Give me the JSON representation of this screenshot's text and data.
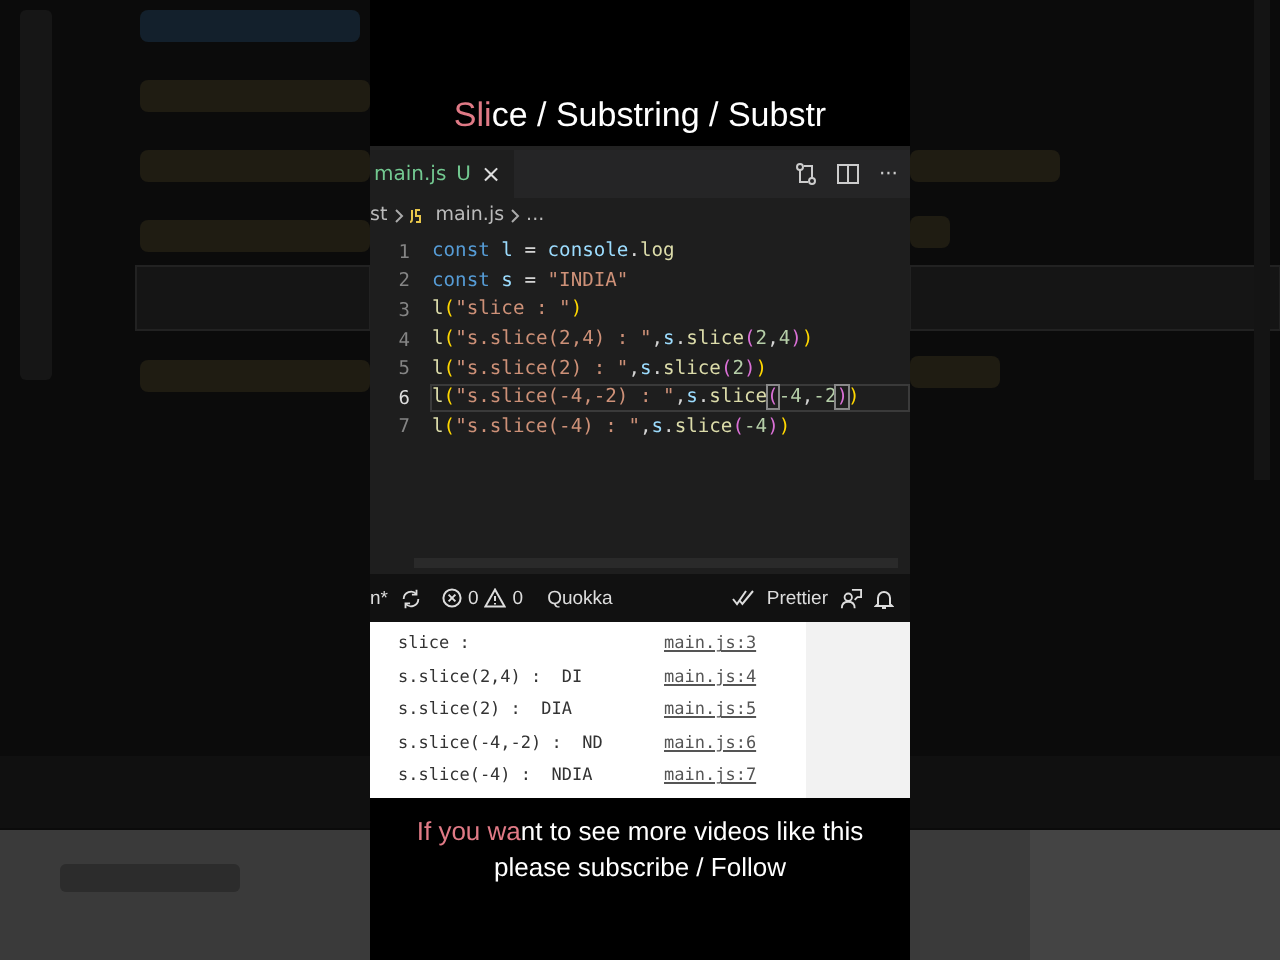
{
  "caption": {
    "highlight": "Sli",
    "rest": "ce / Substring / Substr"
  },
  "editor": {
    "tab": {
      "label": "main.js",
      "status": "U",
      "close": "×",
      "selected": true
    },
    "more": "···",
    "breadcrumb": [
      "st",
      "main.js",
      "..."
    ],
    "lines": [
      {
        "number": "1",
        "current": false,
        "tokens": [
          {
            "text": "const ",
            "kind": "kw"
          },
          {
            "text": "l",
            "kind": "var"
          },
          {
            "text": " = ",
            "kind": "op"
          },
          {
            "text": "console",
            "kind": "var"
          },
          {
            "text": ".",
            "kind": "op"
          },
          {
            "text": "log",
            "kind": "fn"
          }
        ]
      },
      {
        "number": "2",
        "current": false,
        "tokens": [
          {
            "text": "const ",
            "kind": "kw"
          },
          {
            "text": "s",
            "kind": "var"
          },
          {
            "text": " = ",
            "kind": "op"
          },
          {
            "text": "\"INDIA\"",
            "kind": "str"
          }
        ]
      },
      {
        "number": "3",
        "current": false,
        "tokens": [
          {
            "text": "l",
            "kind": "fn"
          },
          {
            "text": "(",
            "kind": "b1"
          },
          {
            "text": "\"slice : \"",
            "kind": "str"
          },
          {
            "text": ")",
            "kind": "b1"
          }
        ]
      },
      {
        "number": "4",
        "current": false,
        "tokens": [
          {
            "text": "l",
            "kind": "fn"
          },
          {
            "text": "(",
            "kind": "b1"
          },
          {
            "text": "\"s.slice(2,4) : \"",
            "kind": "str"
          },
          {
            "text": ",",
            "kind": "op"
          },
          {
            "text": "s",
            "kind": "var"
          },
          {
            "text": ".",
            "kind": "op"
          },
          {
            "text": "slice",
            "kind": "fn"
          },
          {
            "text": "(",
            "kind": "b2"
          },
          {
            "text": "2",
            "kind": "num"
          },
          {
            "text": ",",
            "kind": "op"
          },
          {
            "text": "4",
            "kind": "num"
          },
          {
            "text": ")",
            "kind": "b2"
          },
          {
            "text": ")",
            "kind": "b1"
          }
        ]
      },
      {
        "number": "5",
        "current": false,
        "tokens": [
          {
            "text": "l",
            "kind": "fn"
          },
          {
            "text": "(",
            "kind": "b1"
          },
          {
            "text": "\"s.slice(2) : \"",
            "kind": "str"
          },
          {
            "text": ",",
            "kind": "op"
          },
          {
            "text": "s",
            "kind": "var"
          },
          {
            "text": ".",
            "kind": "op"
          },
          {
            "text": "slice",
            "kind": "fn"
          },
          {
            "text": "(",
            "kind": "b2"
          },
          {
            "text": "2",
            "kind": "num"
          },
          {
            "text": ")",
            "kind": "b2"
          },
          {
            "text": ")",
            "kind": "b1"
          }
        ]
      },
      {
        "number": "6",
        "current": true,
        "tokens": [
          {
            "text": "l",
            "kind": "fn"
          },
          {
            "text": "(",
            "kind": "b1"
          },
          {
            "text": "\"s.slice(-4,-2) : \"",
            "kind": "str"
          },
          {
            "text": ",",
            "kind": "op"
          },
          {
            "text": "s",
            "kind": "var"
          },
          {
            "text": ".",
            "kind": "op"
          },
          {
            "text": "slice",
            "kind": "fn"
          },
          {
            "text": "(",
            "kind": "match"
          },
          {
            "text": "-4",
            "kind": "num"
          },
          {
            "text": ",",
            "kind": "op"
          },
          {
            "text": "-2",
            "kind": "num"
          },
          {
            "text": ")",
            "kind": "match"
          },
          {
            "text": ")",
            "kind": "b1"
          }
        ]
      },
      {
        "number": "7",
        "current": false,
        "tokens": [
          {
            "text": "l",
            "kind": "fn"
          },
          {
            "text": "(",
            "kind": "b1"
          },
          {
            "text": "\"s.slice(-4) : \"",
            "kind": "str"
          },
          {
            "text": ",",
            "kind": "op"
          },
          {
            "text": "s",
            "kind": "var"
          },
          {
            "text": ".",
            "kind": "op"
          },
          {
            "text": "slice",
            "kind": "fn"
          },
          {
            "text": "(",
            "kind": "b2"
          },
          {
            "text": "-4",
            "kind": "num"
          },
          {
            "text": ")",
            "kind": "b2"
          },
          {
            "text": ")",
            "kind": "b1"
          }
        ]
      }
    ]
  },
  "status_bar": {
    "branch": "n*",
    "errors": "0",
    "warnings": "0",
    "extension": "Quokka",
    "formatter": "Prettier"
  },
  "console": [
    {
      "message": "slice :",
      "source": "main.js:3"
    },
    {
      "message": "s.slice(2,4) :  DI",
      "source": "main.js:4"
    },
    {
      "message": "s.slice(2) :  DIA",
      "source": "main.js:5"
    },
    {
      "message": "s.slice(-4,-2) :  ND",
      "source": "main.js:6"
    },
    {
      "message": "s.slice(-4) :  NDIA",
      "source": "main.js:7"
    }
  ],
  "subtitle": {
    "highlight": "If you wa",
    "rest": "nt to see more videos like this please subscribe / Follow"
  }
}
